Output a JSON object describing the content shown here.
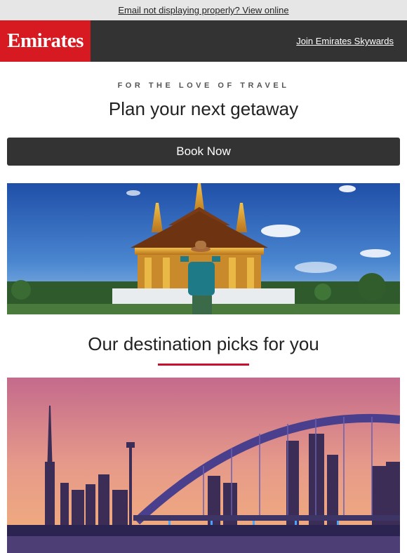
{
  "topbar": {
    "view_online": "Email not displaying properly? View online"
  },
  "header": {
    "logo_text": "Emirates",
    "join_link": "Join Emirates Skywards",
    "colors": {
      "brand_red": "#d71921",
      "header_bg": "#333333"
    }
  },
  "hero": {
    "kicker": "FOR THE LOVE OF TRAVEL",
    "headline": "Plan your next getaway",
    "cta_label": "Book Now"
  },
  "picks": {
    "title": "Our destination picks for you",
    "accent_color": "#c8102e"
  }
}
